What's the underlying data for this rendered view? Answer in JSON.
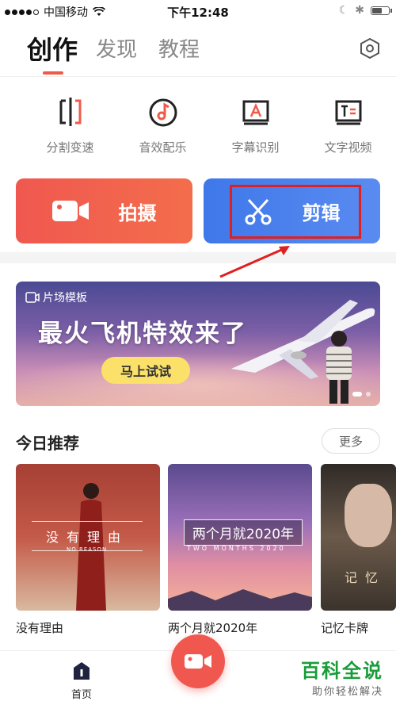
{
  "status_bar": {
    "carrier": "中国移动",
    "time": "下午12:48"
  },
  "tabs": [
    {
      "label": "创作",
      "active": true
    },
    {
      "label": "发现",
      "active": false
    },
    {
      "label": "教程",
      "active": false
    }
  ],
  "tools": [
    {
      "label": "分割变速",
      "icon": "split-speed-icon"
    },
    {
      "label": "音效配乐",
      "icon": "music-note-icon"
    },
    {
      "label": "字幕识别",
      "icon": "subtitle-a-icon"
    },
    {
      "label": "文字视频",
      "icon": "text-video-icon"
    }
  ],
  "actions": {
    "shoot_label": "拍摄",
    "edit_label": "剪辑"
  },
  "banner": {
    "tag": "片场模板",
    "title": "最火飞机特效来了",
    "button": "马上试试",
    "page_count": 2,
    "active_page": 1
  },
  "recommend": {
    "title": "今日推荐",
    "more": "更多",
    "cards": [
      {
        "label": "没有理由",
        "overlay": "没有理由",
        "overlay_sub": "NO REASON"
      },
      {
        "label": "两个月就2020年",
        "overlay": "两个月就2020年",
        "overlay_sub": "TWO MONTHS 2020"
      },
      {
        "label": "记忆卡牌",
        "overlay": "记忆"
      }
    ]
  },
  "bottom_nav": {
    "home_label": "首页"
  },
  "watermark": {
    "line1": "百科全说",
    "line2": "助你轻松解决"
  },
  "colors": {
    "shoot": "#f0584f",
    "edit": "#3f78ea",
    "accent_underline": "#f05a4a",
    "highlight": "#e02020"
  }
}
